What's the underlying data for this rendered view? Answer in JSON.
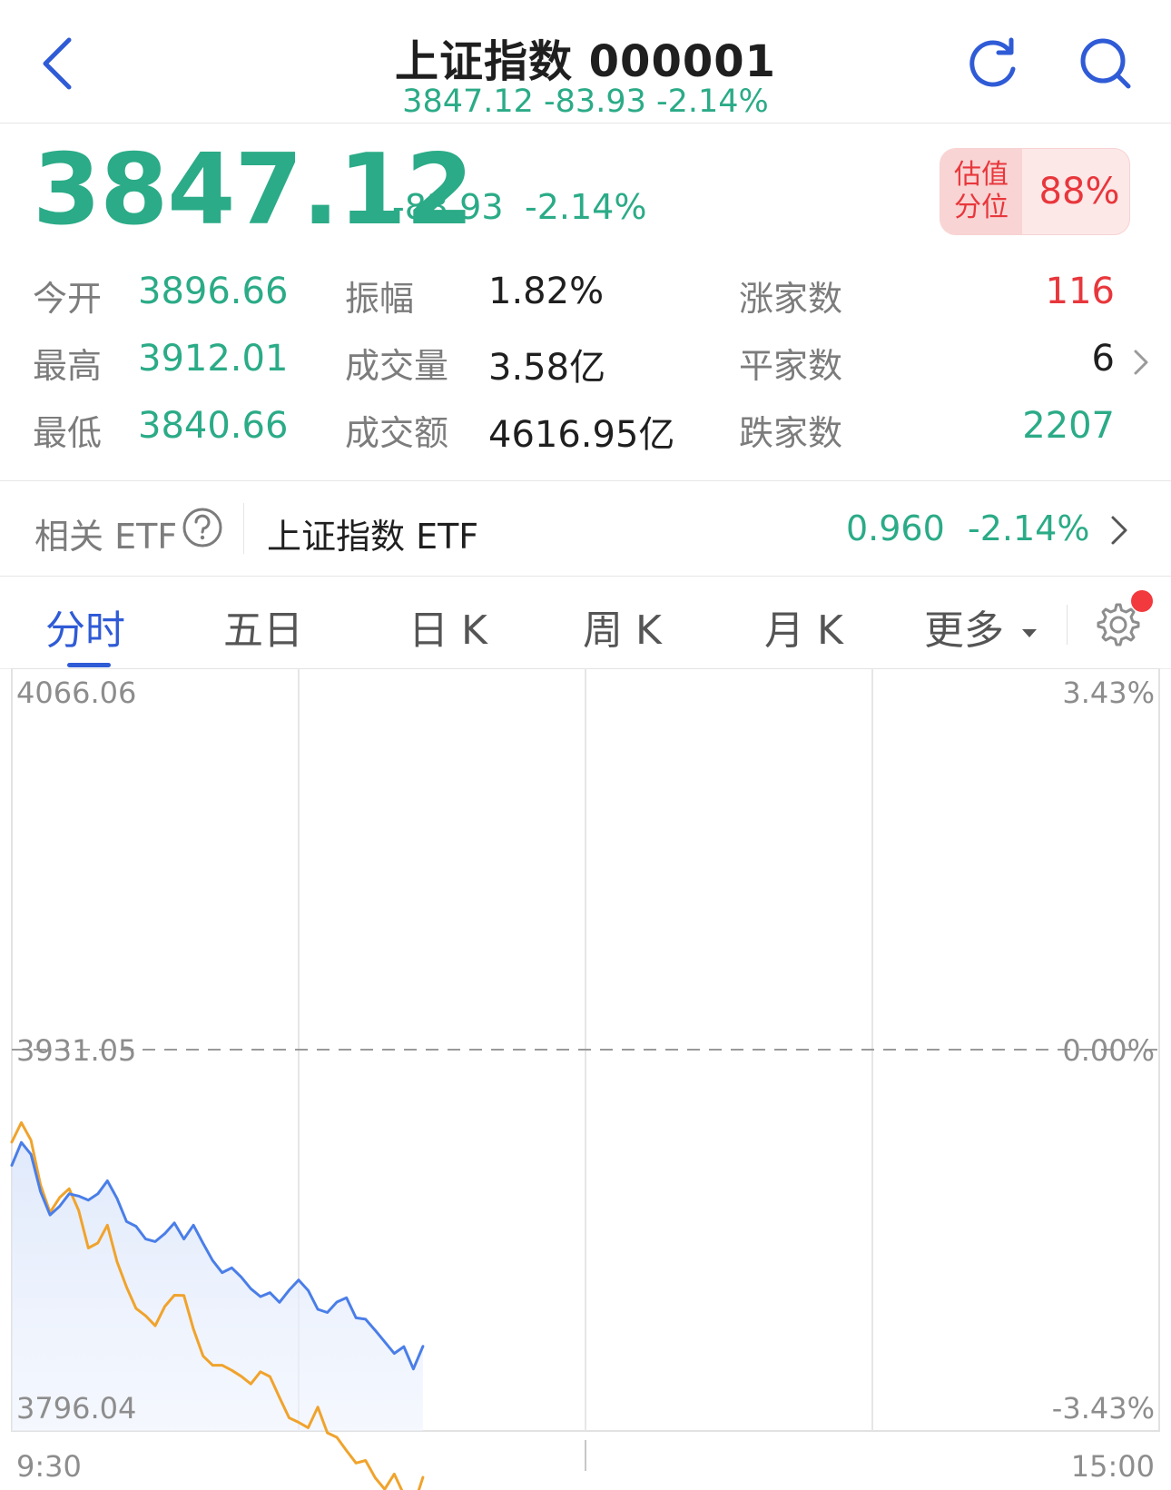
{
  "header": {
    "title": "上证指数 000001",
    "subtitle": "3847.12 -83.93 -2.14%"
  },
  "quote": {
    "price": "3847.12",
    "change": "-83.93",
    "change_pct": "-2.14%",
    "valuation_label": "估值\n分位",
    "valuation_value": "88%"
  },
  "stats": {
    "open_label": "今开",
    "open": "3896.66",
    "high_label": "最高",
    "high": "3912.01",
    "low_label": "最低",
    "low": "3840.66",
    "amplitude_label": "振幅",
    "amplitude": "1.82%",
    "volume_label": "成交量",
    "volume": "3.58亿",
    "turnover_label": "成交额",
    "turnover": "4616.95亿",
    "up_label": "涨家数",
    "up": "116",
    "flat_label": "平家数",
    "flat": "6",
    "down_label": "跌家数",
    "down": "2207"
  },
  "etf": {
    "label": "相关 ETF",
    "name": "上证指数 ETF",
    "price": "0.960",
    "change_pct": "-2.14%"
  },
  "tabs": [
    {
      "label": "分时",
      "active": true
    },
    {
      "label": "五日",
      "active": false
    },
    {
      "label": "日 K",
      "active": false
    },
    {
      "label": "周 K",
      "active": false
    },
    {
      "label": "月 K",
      "active": false
    },
    {
      "label": "更多",
      "active": false
    }
  ],
  "colors": {
    "green": "#2bab87",
    "red": "#e8373c",
    "accent_blue": "#2f5bd6",
    "line_blue": "#4a7ee8",
    "line_orange": "#f0a32c"
  },
  "chart_data": {
    "type": "line",
    "ylim": [
      3796.04,
      4066.06
    ],
    "y_ticks_left": [
      "4066.06",
      "3931.05",
      "3796.04"
    ],
    "y_ticks_right": [
      "3.43%",
      "0.00%",
      "-3.43%"
    ],
    "x_ticks": [
      "9:30",
      "15:00"
    ],
    "baseline": 3931.05,
    "total_minutes": 240,
    "series": [
      {
        "color": "#4a7ee8",
        "x": [
          0,
          2,
          4,
          6,
          8,
          10,
          12,
          14,
          16,
          18,
          20,
          22,
          24,
          26,
          28,
          30,
          32,
          34,
          36,
          38,
          40,
          42,
          44,
          46,
          48,
          50,
          52,
          54,
          56,
          58,
          60,
          62,
          64,
          66,
          68,
          70,
          72,
          74,
          76,
          78,
          80,
          82,
          84,
          86
        ],
        "values": [
          3890.1,
          3898.2,
          3894.0,
          3880.8,
          3872.5,
          3875.6,
          3880.0,
          3879.2,
          3877.8,
          3880.0,
          3884.6,
          3878.4,
          3870.2,
          3868.5,
          3864.0,
          3863.1,
          3865.9,
          3869.7,
          3864.0,
          3868.9,
          3862.5,
          3856.4,
          3852.1,
          3853.8,
          3850.5,
          3846.4,
          3843.6,
          3845.0,
          3841.6,
          3845.9,
          3849.5,
          3845.8,
          3839.1,
          3838.0,
          3841.7,
          3843.2,
          3836.1,
          3835.6,
          3831.7,
          3827.6,
          3823.5,
          3825.9,
          3818.0,
          3826.0
        ]
      },
      {
        "color": "#f0a32c",
        "x": [
          0,
          2,
          4,
          6,
          8,
          10,
          12,
          14,
          16,
          18,
          20,
          22,
          24,
          26,
          28,
          30,
          32,
          34,
          36,
          38,
          40,
          42,
          44,
          46,
          48,
          50,
          52,
          54,
          56,
          58,
          60,
          62,
          64,
          66,
          68,
          70,
          72,
          74,
          76,
          78,
          80,
          82,
          84,
          86
        ],
        "values": [
          3898.3,
          3905.2,
          3899.0,
          3883.2,
          3873.4,
          3878.7,
          3881.8,
          3874.1,
          3860.8,
          3862.6,
          3868.9,
          3856.0,
          3847.0,
          3839.4,
          3836.8,
          3833.3,
          3840.1,
          3844.1,
          3844.0,
          3832.1,
          3822.6,
          3819.3,
          3819.3,
          3817.5,
          3815.4,
          3812.7,
          3817.0,
          3815.3,
          3807.9,
          3800.7,
          3799.1,
          3797.2,
          3804.5,
          3795.4,
          3793.8,
          3789.1,
          3784.7,
          3785.6,
          3779.5,
          3775.4,
          3780.8,
          3773.5,
          3769.2,
          3779.6
        ]
      }
    ]
  }
}
